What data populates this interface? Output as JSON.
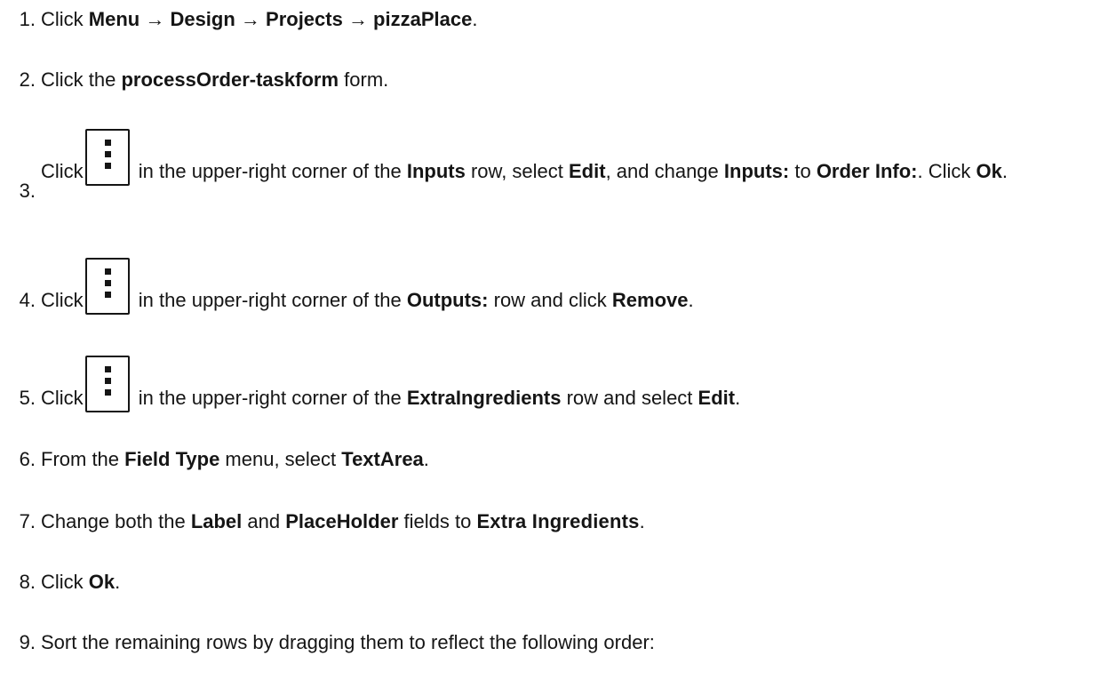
{
  "steps": [
    {
      "number": "1.",
      "parts": {
        "t1": "Click ",
        "b1": "Menu → Design → Projects → pizzaPlace",
        "t2": "."
      }
    },
    {
      "number": "2.",
      "parts": {
        "t1": "Click the ",
        "b1": "processOrder-taskform",
        "t2": " form."
      }
    },
    {
      "number": "3.",
      "parts": {
        "t1": "Click",
        "t2": " in the upper-right corner of the ",
        "b1": "Inputs",
        "t3": " row, select ",
        "b2": "Edit",
        "t4": ", and change ",
        "b3": "Inputs:",
        "t5": " to ",
        "b4": "Order Info:",
        "t6": ". Click ",
        "b5": "Ok",
        "t7": "."
      },
      "icon": "kebab-menu-icon"
    },
    {
      "number": "4.",
      "parts": {
        "t1": "Click",
        "t2": " in the upper-right corner of the ",
        "b1": "Outputs:",
        "t3": " row and click ",
        "b2": "Remove",
        "t4": "."
      },
      "icon": "kebab-menu-icon"
    },
    {
      "number": "5.",
      "parts": {
        "t1": "Click",
        "t2": " in the upper-right corner of the ",
        "b1": "ExtraIngredients",
        "t3": " row and select ",
        "b2": "Edit",
        "t4": "."
      },
      "icon": "kebab-menu-icon"
    },
    {
      "number": "6.",
      "parts": {
        "t1": "From the ",
        "b1": "Field Type",
        "t2": " menu, select ",
        "b2": "TextArea",
        "t3": "."
      }
    },
    {
      "number": "7.",
      "parts": {
        "t1": "Change both the ",
        "b1": "Label",
        "t2": " and ",
        "b2": "PlaceHolder",
        "t3": " fields to ",
        "b3": "Extra Ingredients",
        "t4": "."
      }
    },
    {
      "number": "8.",
      "parts": {
        "t1": "Click ",
        "b1": "Ok",
        "t2": "."
      }
    },
    {
      "number": "9.",
      "parts": {
        "t1": "Sort the remaining rows by dragging them to reflect the following order:"
      }
    }
  ],
  "colors": {
    "text": "#151515",
    "background": "#ffffff"
  }
}
